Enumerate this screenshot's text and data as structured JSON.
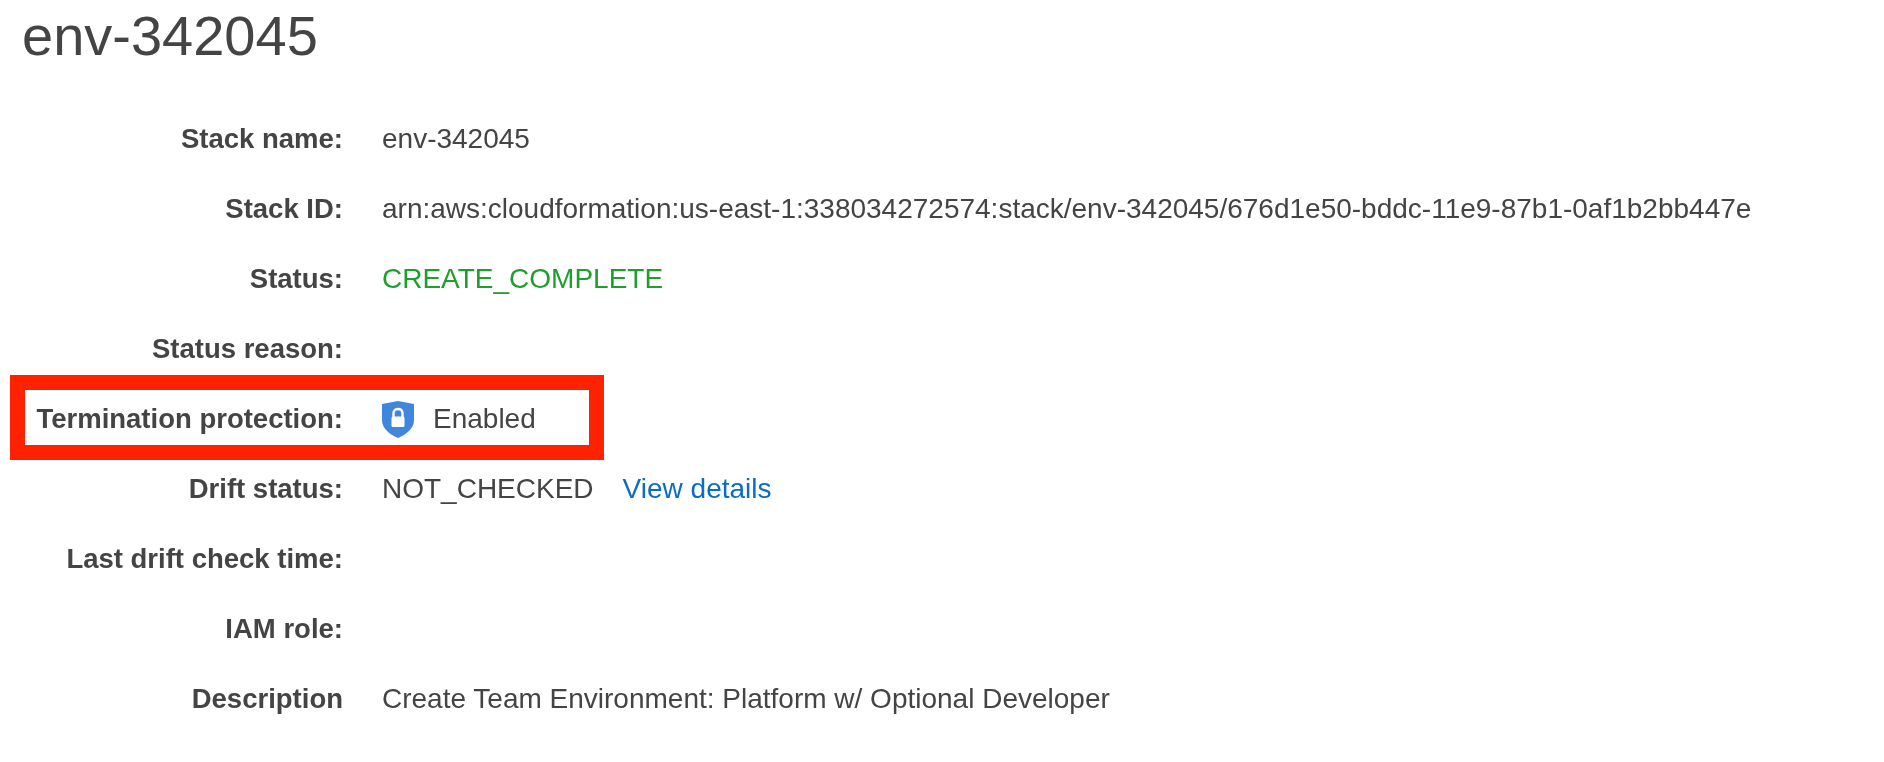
{
  "title": "env-342045",
  "fields": [
    {
      "label": "Stack name:",
      "value": "env-342045",
      "kind": "text",
      "highlighted": false
    },
    {
      "label": "Stack ID:",
      "value": "arn:aws:cloudformation:us-east-1:338034272574:stack/env-342045/676d1e50-bddc-11e9-87b1-0af1b2bb447e",
      "kind": "text",
      "highlighted": false
    },
    {
      "label": "Status:",
      "value": "CREATE_COMPLETE",
      "kind": "status",
      "highlighted": false
    },
    {
      "label": "Status reason:",
      "kind": "text",
      "highlighted": false
    },
    {
      "label": "Termination protection:",
      "value": "Enabled",
      "kind": "protection",
      "highlighted": true
    },
    {
      "label": "Drift status:",
      "value": "NOT_CHECKED",
      "link": "View details",
      "kind": "text",
      "highlighted": false
    },
    {
      "label": "Last drift check time:",
      "kind": "text",
      "highlighted": false
    },
    {
      "label": "IAM role:",
      "kind": "text",
      "highlighted": false
    },
    {
      "label": "Description",
      "value": "Create Team Environment: Platform w/ Optional Developer",
      "kind": "text",
      "highlighted": false
    }
  ]
}
